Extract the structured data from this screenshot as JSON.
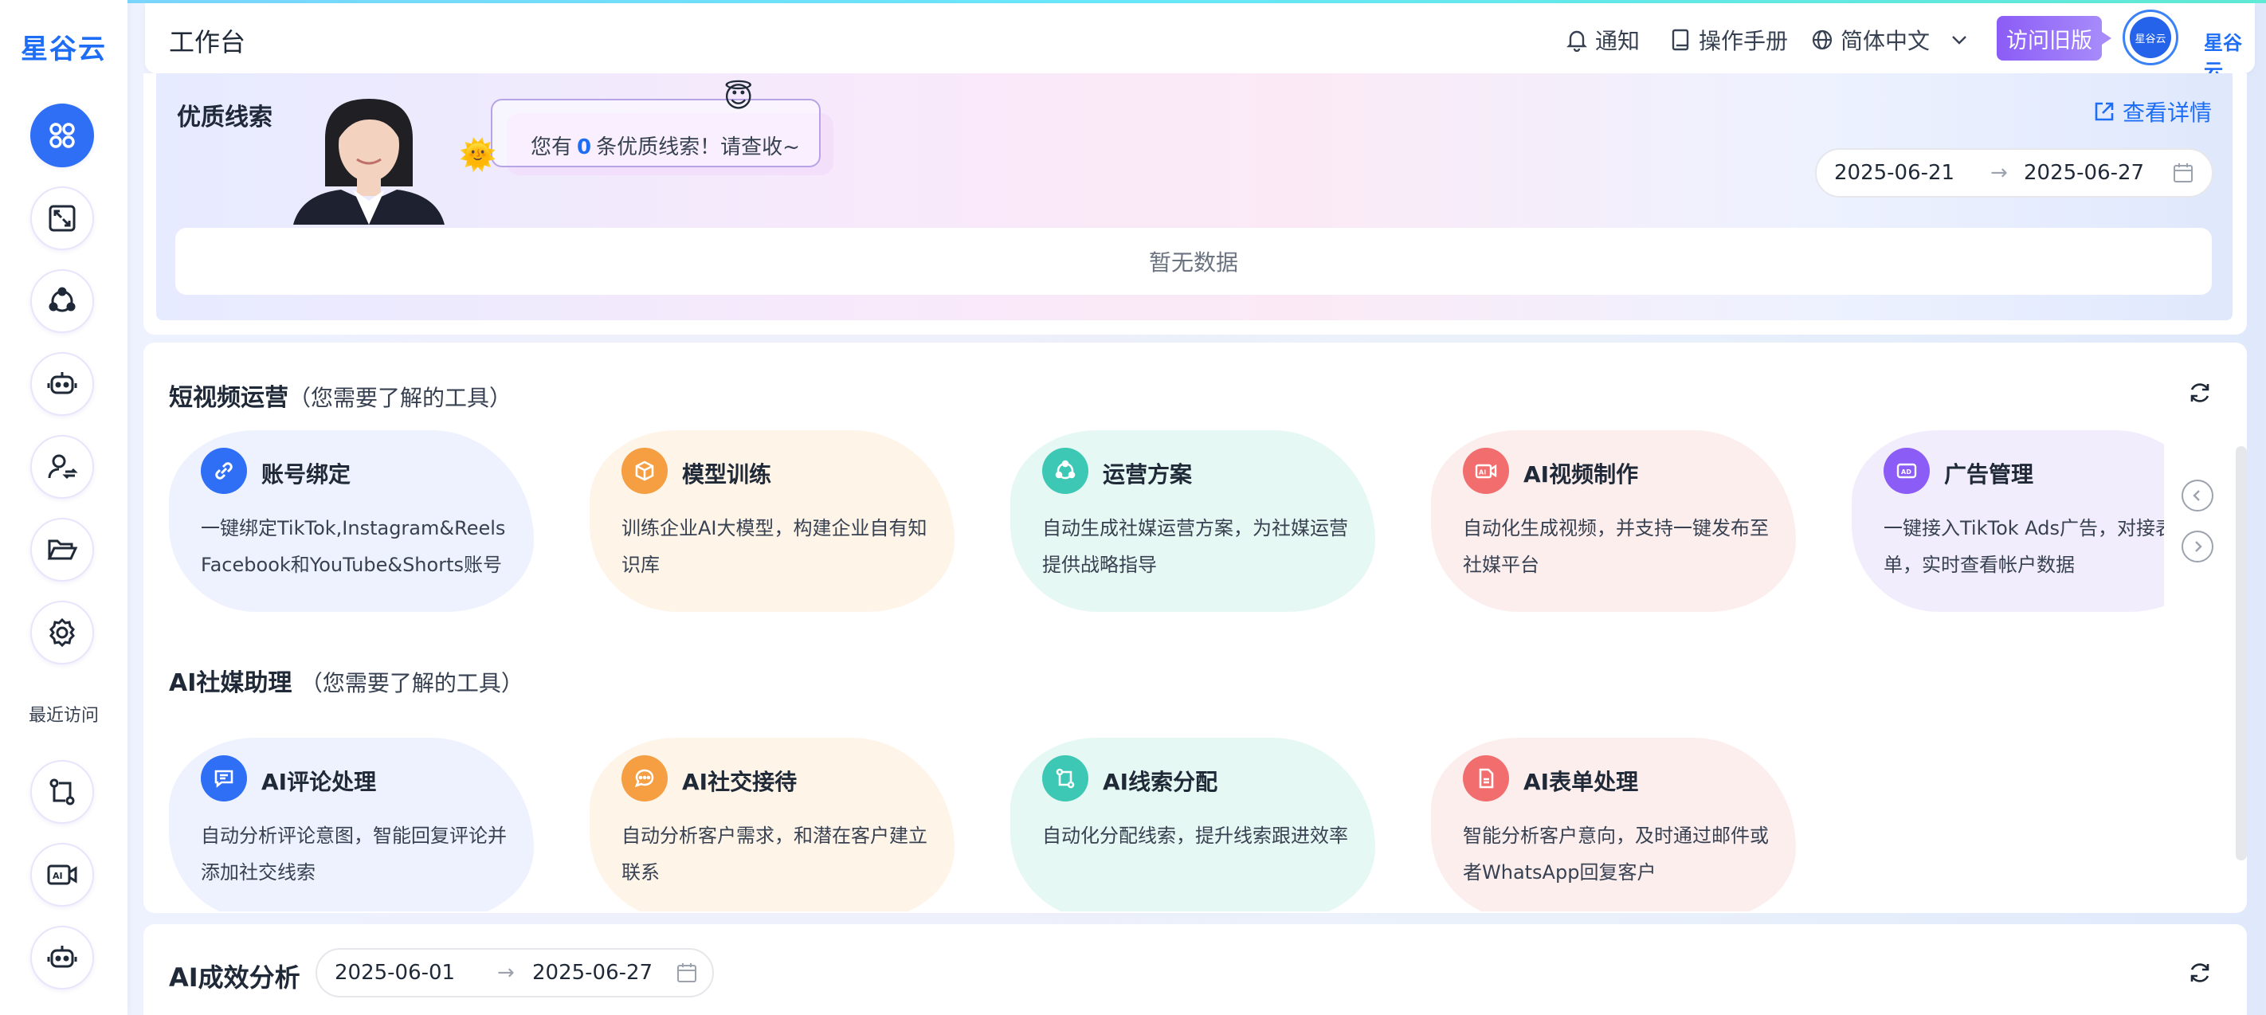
{
  "sidebar": {
    "logo": "星谷云",
    "recent_label": "最近访问"
  },
  "header": {
    "title": "工作台",
    "notify": "通知",
    "manual": "操作手册",
    "language": "简体中文",
    "old_version": "访问旧版",
    "avatar_text": "星谷云",
    "brand": "星谷云"
  },
  "leads": {
    "title": "优质线索",
    "bubble_prefix": "您有",
    "bubble_count": "0",
    "bubble_suffix": "条优质线索！请查收~",
    "view_detail": "查看详情",
    "date_start": "2025-06-21",
    "date_sep": "→",
    "date_end": "2025-06-27",
    "empty": "暂无数据"
  },
  "short_video": {
    "title": "短视频运营",
    "hint": "（您需要了解的工具）",
    "cards": [
      {
        "title": "账号绑定",
        "desc": "一键绑定TikTok,Instagram&Reels Facebook和YouTube&Shorts账号",
        "color": "#2f6ff5",
        "bg": "#eef2fe"
      },
      {
        "title": "模型训练",
        "desc": "训练企业AI大模型，构建企业自有知识库",
        "color": "#f59e42",
        "bg": "#fef4e8"
      },
      {
        "title": "运营方案",
        "desc": "自动生成社媒运营方案，为社媒运营提供战略指导",
        "color": "#3cc8b4",
        "bg": "#e6f8f3"
      },
      {
        "title": "AI视频制作",
        "desc": "自动化生成视频，并支持一键发布至社媒平台",
        "color": "#f26d6d",
        "bg": "#fdeeee"
      },
      {
        "title": "广告管理",
        "desc": "一键接入TikTok Ads广告，对接表单，实时查看帐户数据",
        "color": "#8b5cf6",
        "bg": "#f1edfd"
      }
    ]
  },
  "ai_assistant": {
    "title": "AI社媒助理",
    "hint": "（您需要了解的工具）",
    "cards": [
      {
        "title": "AI评论处理",
        "desc": "自动分析评论意图，智能回复评论并添加社交线索",
        "color": "#2f6ff5",
        "bg": "#eef2fe"
      },
      {
        "title": "AI社交接待",
        "desc": "自动分析客户需求，和潜在客户建立联系",
        "color": "#f59e42",
        "bg": "#fef4e8"
      },
      {
        "title": "AI线索分配",
        "desc": "自动化分配线索，提升线索跟进效率",
        "color": "#3cc8b4",
        "bg": "#e6f8f3"
      },
      {
        "title": "AI表单处理",
        "desc": "智能分析客户意向，及时通过邮件或者WhatsApp回复客户",
        "color": "#f26d6d",
        "bg": "#fdeeee"
      }
    ]
  },
  "effect": {
    "title": "AI成效分析",
    "date_start": "2025-06-01",
    "date_sep": "→",
    "date_end": "2025-06-27"
  }
}
